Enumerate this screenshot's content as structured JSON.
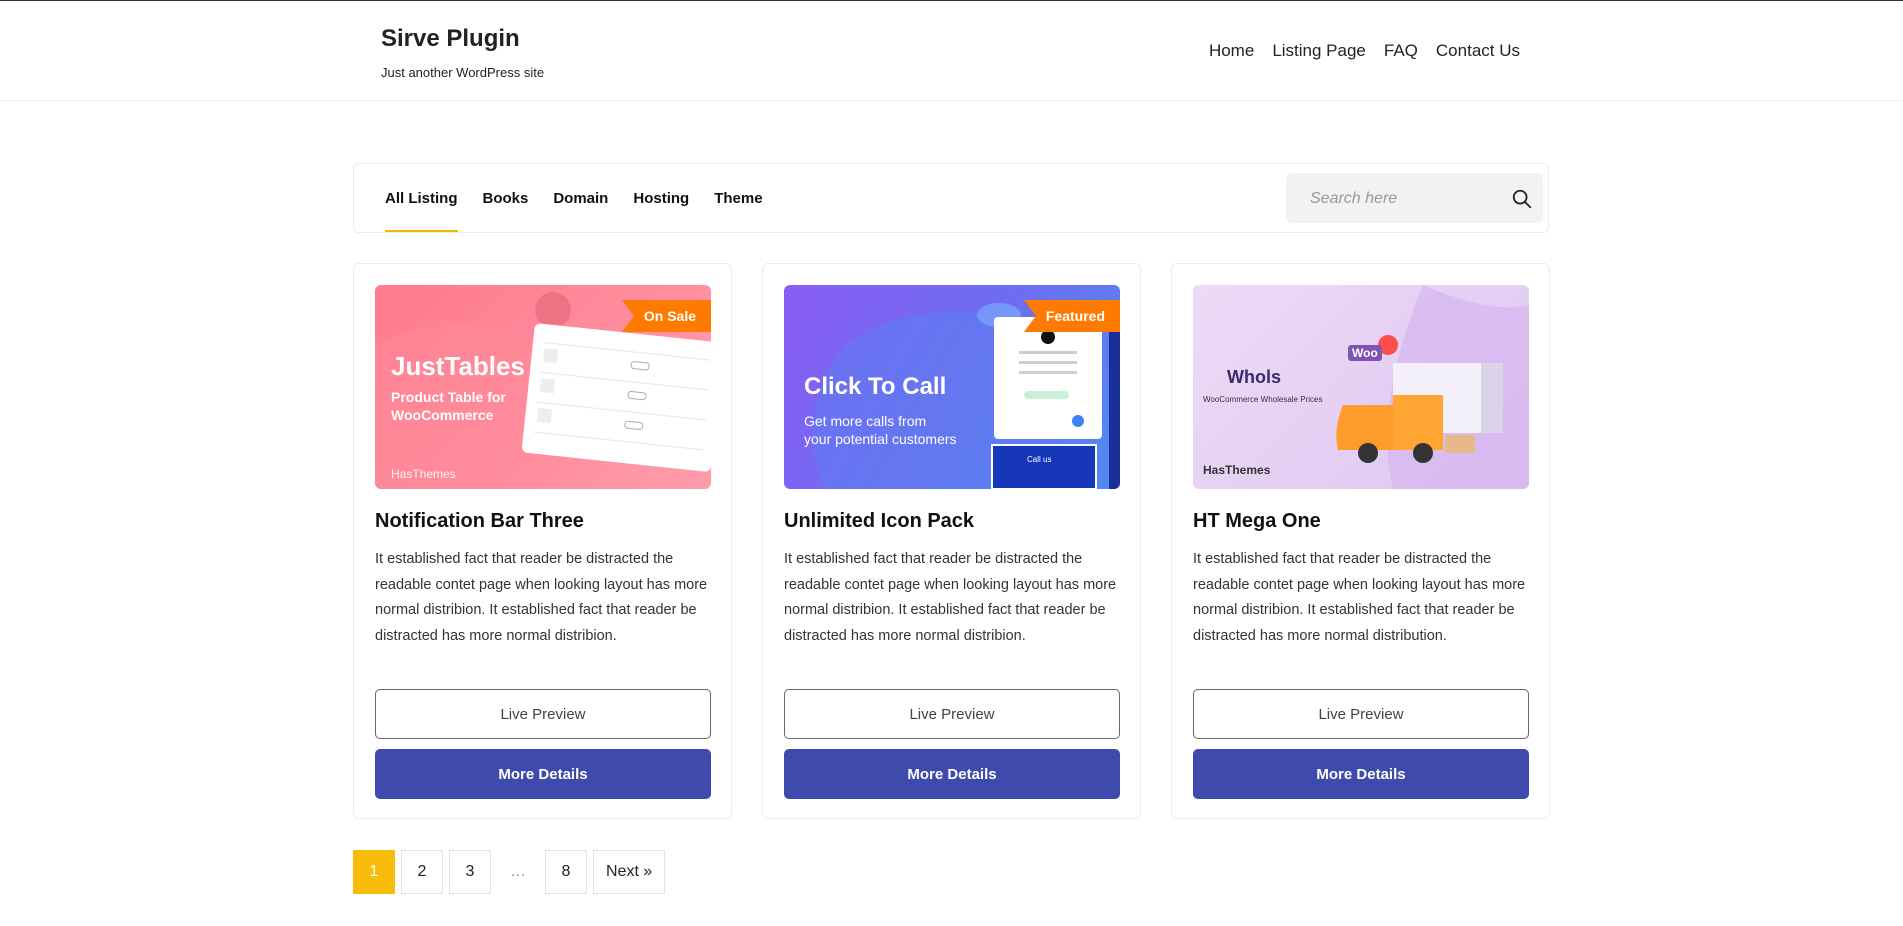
{
  "site": {
    "title": "Sirve Plugin",
    "tagline": "Just another WordPress site"
  },
  "nav": {
    "items": [
      "Home",
      "Listing Page",
      "FAQ",
      "Contact Us"
    ]
  },
  "filters": {
    "tabs": [
      "All Listing",
      "Books",
      "Domain",
      "Hosting",
      "Theme"
    ],
    "active": "All Listing",
    "search_placeholder": "Search here"
  },
  "cards": [
    {
      "badge": "On Sale",
      "image_text": {
        "headline": "JustTables",
        "line1": "Product Table for",
        "line2": "WooCommerce",
        "brand": "HasThemes"
      },
      "title": "Notification Bar Three",
      "description": "It established fact that reader be distracted the readable contet page when looking layout has more normal distribion. It established fact that reader be distracted has more normal distribion.",
      "preview_label": "Live Preview",
      "details_label": "More Details"
    },
    {
      "badge": "Featured",
      "image_text": {
        "headline": "Click To Call",
        "line1": "Get more calls from",
        "line2": "your potential customers",
        "brand": "Call us"
      },
      "title": "Unlimited Icon Pack",
      "description": "It established fact that reader be distracted the readable contet page when looking layout has more normal distribion. It established fact that reader be distracted has more normal distribion.",
      "preview_label": "Live Preview",
      "details_label": "More Details"
    },
    {
      "badge": "",
      "image_text": {
        "headline": "Whols",
        "line1": "WooCommerce Wholesale Prices",
        "line2": "Woo",
        "brand": "HasThemes"
      },
      "title": "HT Mega One",
      "description": "It established fact that reader be distracted the readable contet page when looking layout has more normal distribion. It established fact that reader be distracted has more normal distribution.",
      "preview_label": "Live Preview",
      "details_label": "More Details"
    }
  ],
  "pagination": {
    "pages": [
      "1",
      "2",
      "3",
      "…",
      "8"
    ],
    "current": "1",
    "next_label": "Next »"
  },
  "colors": {
    "accent": "#f7bd0a",
    "primary_button": "#3f4aad",
    "badge": "#ff7a00"
  }
}
